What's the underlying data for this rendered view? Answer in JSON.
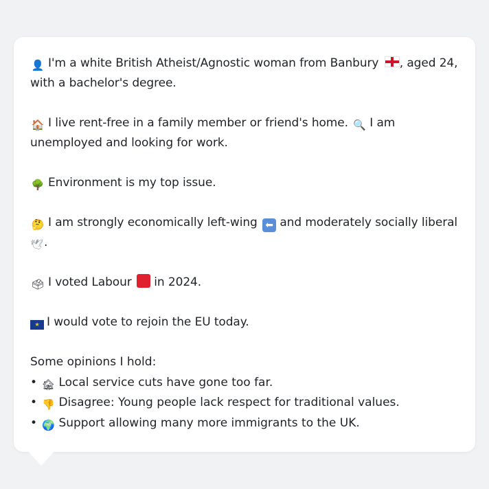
{
  "profile": {
    "line1_pre": "I'm a white British Atheist/Agnostic woman from Banbury",
    "line1_post": ", aged 24, with a bachelor's degree.",
    "line2a": "I live rent-free in a family member or friend's home.",
    "line2b": "I am unemployed and looking for work.",
    "line3": "Environment is my top issue.",
    "line4_pre": "I am strongly economically left-wing",
    "line4_post": "and moderately socially liberal",
    "line4_end": ".",
    "line5_pre": "I voted Labour",
    "line5_post": "in 2024.",
    "line6": "I would vote to rejoin the EU today."
  },
  "opinions": {
    "heading": "Some opinions I hold:",
    "items": [
      "Local service cuts have gone too far.",
      "Disagree: Young people lack respect for traditional values.",
      "Support allowing many more immigrants to the UK."
    ]
  },
  "icons": {
    "person": "bust-in-silhouette-icon",
    "home": "house-icon",
    "search": "magnifying-glass-icon",
    "environment": "tree-icon",
    "thinking": "thinking-face-icon",
    "left_arrow": "left-arrow-icon",
    "dove": "dove-icon",
    "ballot": "ballot-box-icon",
    "labour": "red-square-icon",
    "eu": "eu-flag-icon",
    "derelict": "derelict-house-icon",
    "thumbs_down": "thumbs-down-icon",
    "globe": "globe-icon"
  },
  "colors": {
    "background": "#f1f2f4",
    "card": "#ffffff",
    "text": "#1f2328",
    "labour_red": "#e0202e",
    "eu_blue": "#173a8f"
  }
}
